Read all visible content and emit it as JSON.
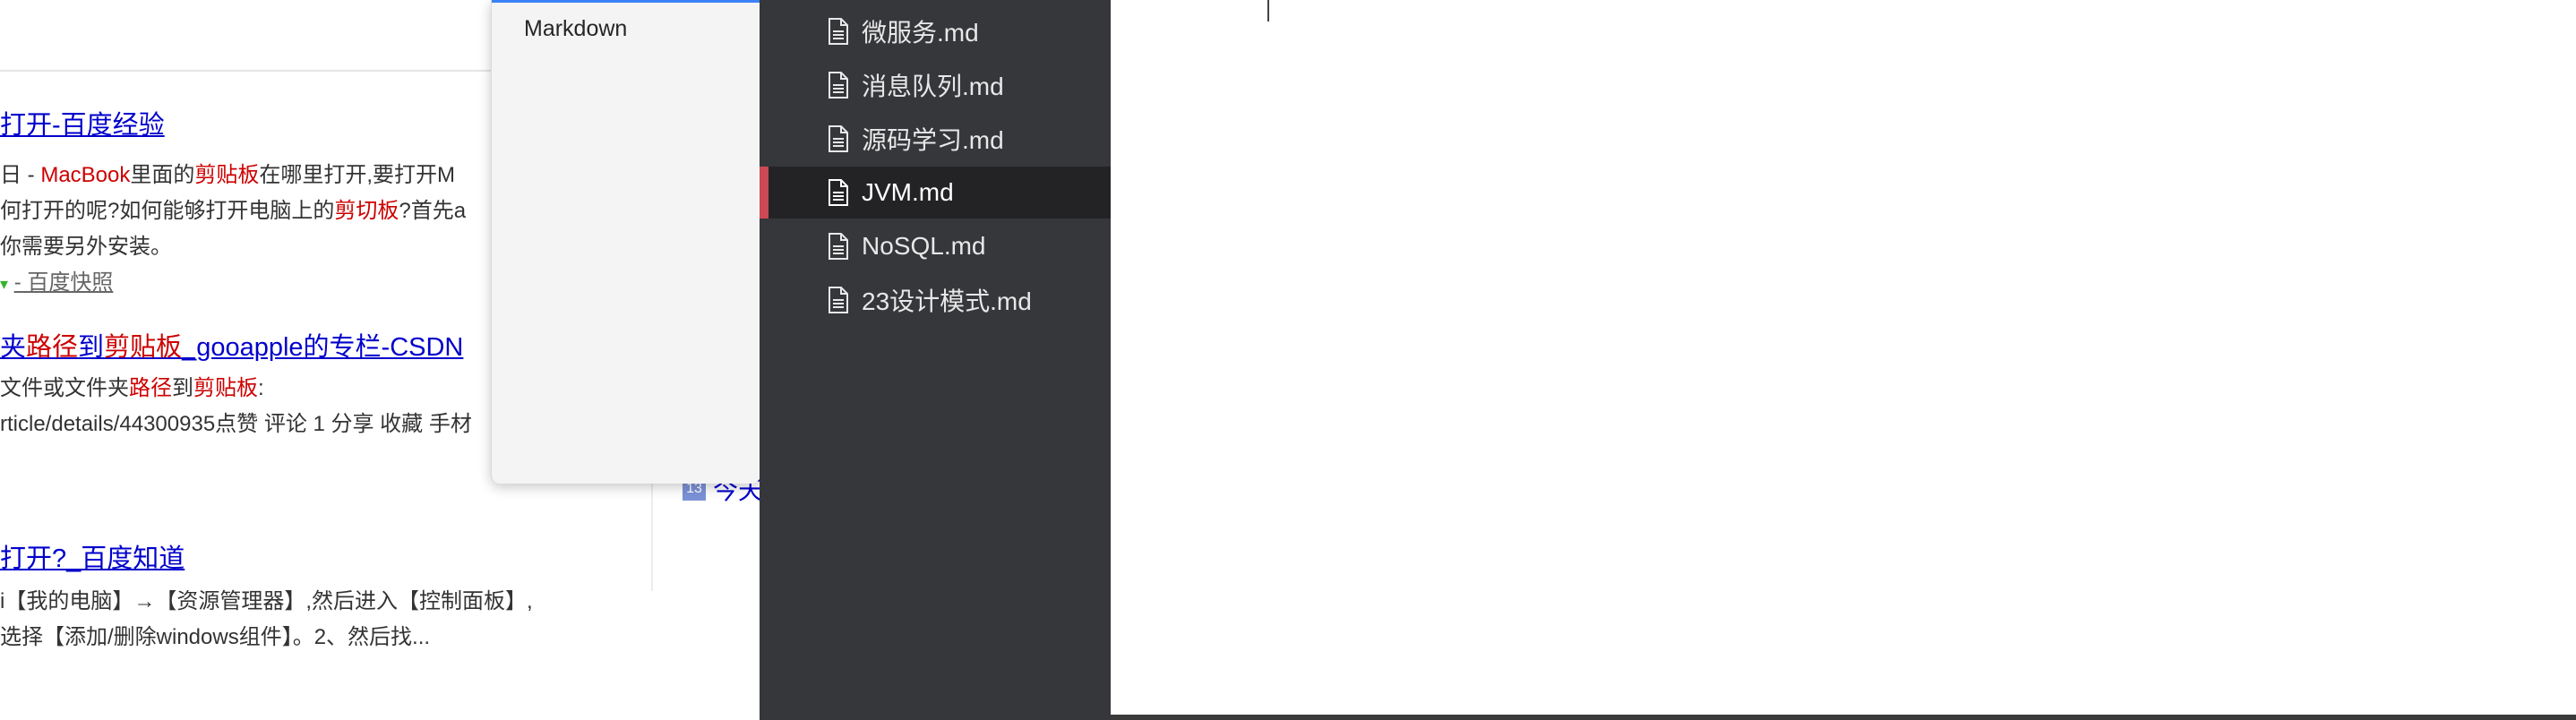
{
  "browser": {
    "results": [
      {
        "title": "打开-百度经验",
        "snippet_line1": [
          "日 - ",
          "MacBook",
          "里面的",
          "剪贴板",
          "在哪里打开,要打开M"
        ],
        "snippet_line2": [
          "何打开的呢?如何能够打开电脑上的",
          "剪切板",
          "?首先a"
        ],
        "snippet_line3": "你需要另外安装。",
        "source": "- 百度快照"
      },
      {
        "title_parts": [
          "夹",
          "路径",
          "到",
          "剪贴板",
          "_gooapple的专栏-CSDN"
        ],
        "snippet_line1": [
          "文件或文件夹",
          "路径",
          "到",
          "剪贴板",
          ":"
        ],
        "snippet_line2": "rticle/details/44300935点赞 评论 1 分享 收藏 手材"
      },
      {
        "title": "打开?_百度知道",
        "snippet_line1": "i【我的电脑】→【资源管理器】,然后进入【控制面板】,",
        "snippet_line2": "选择【添加/删除windows组件】。2、然后找..."
      }
    ],
    "side_icon_text": "13",
    "side_link": "今天"
  },
  "dropdown": {
    "selected": "Markdown"
  },
  "sidebar": {
    "files": [
      {
        "name": "微服务.md",
        "active": false
      },
      {
        "name": "消息队列.md",
        "active": false
      },
      {
        "name": "源码学习.md",
        "active": false
      },
      {
        "name": "JVM.md",
        "active": true
      },
      {
        "name": "NoSQL.md",
        "active": false
      },
      {
        "name": "23设计模式.md",
        "active": false
      }
    ]
  },
  "colors": {
    "sidebar_bg": "#36373b",
    "active_row_bg": "#232326",
    "active_marker": "#cb4a55",
    "link_blue": "#0000cc",
    "highlight_red": "#cc0000"
  }
}
